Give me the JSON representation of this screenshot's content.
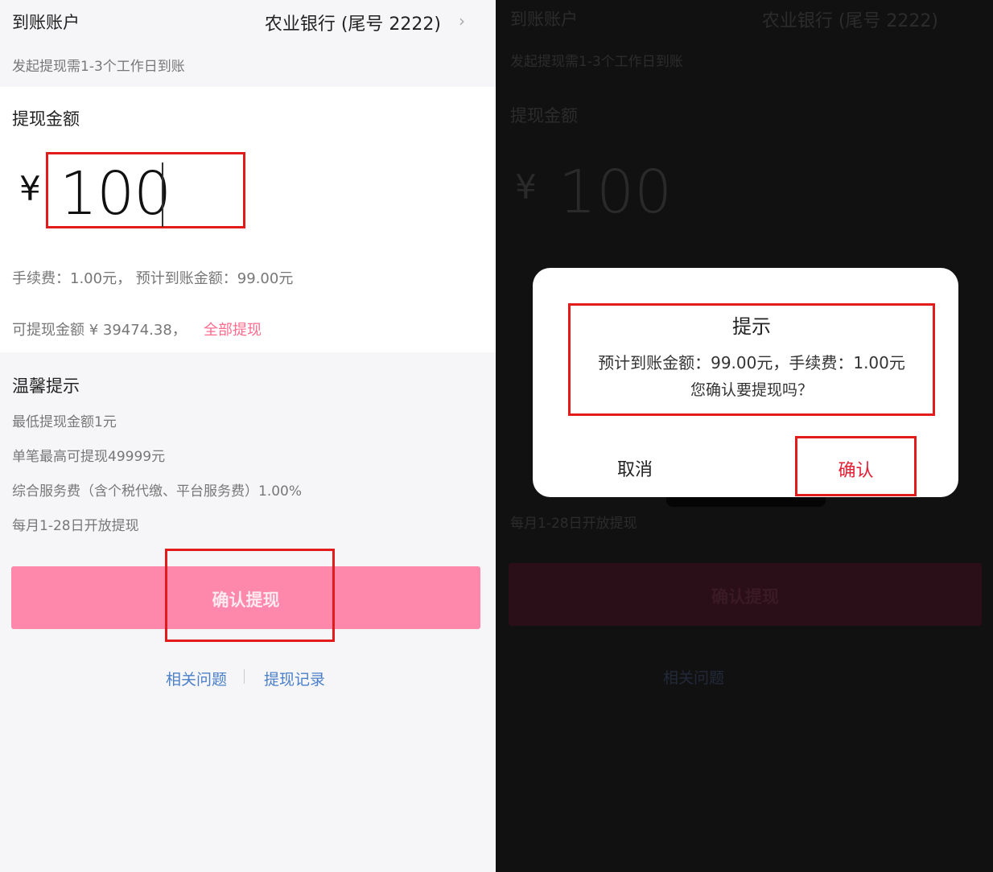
{
  "left": {
    "account": {
      "label": "到账账户",
      "bank": "农业银行 (尾号 2222)",
      "chevron": "›",
      "note": "发起提现需1-3个工作日到账"
    },
    "amount": {
      "title": "提现金额",
      "currency": "¥",
      "value": "100",
      "fee_line": "手续费：1.00元， 预计到账金额：99.00元",
      "available": "可提现金额 ¥ 39474.38，",
      "withdraw_all": "全部提现"
    },
    "tips": {
      "title": "温馨提示",
      "items": [
        "最低提现金额1元",
        "单笔最高可提现49999元",
        "综合服务费（含个税代缴、平台服务费）1.00%",
        "每月1-28日开放提现"
      ]
    },
    "confirm_button": "确认提现",
    "links": {
      "related": "相关问题",
      "records": "提现记录"
    }
  },
  "right": {
    "dialog": {
      "title": "提示",
      "message": "预计到账金额：99.00元，手续费：1.00元",
      "question": "您确认要提现吗？",
      "cancel": "取消",
      "confirm": "确认"
    }
  },
  "colors": {
    "accent_pink": "#fd88ab",
    "highlight_red": "#e21b1b",
    "link_blue": "#4a7fc9",
    "confirm_red": "#e41f34"
  }
}
